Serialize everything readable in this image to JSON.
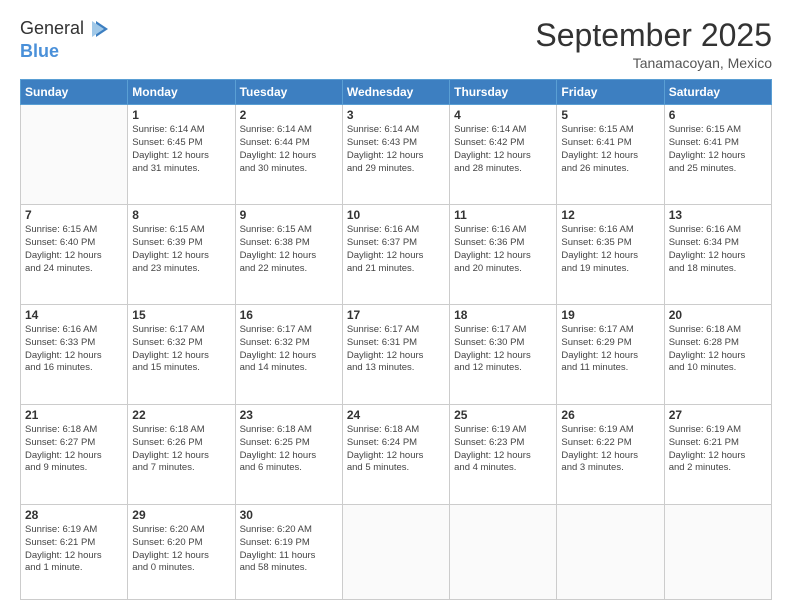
{
  "header": {
    "logo": {
      "text_general": "General",
      "text_blue": "Blue"
    },
    "title": "September 2025",
    "subtitle": "Tanamacoyan, Mexico"
  },
  "calendar": {
    "days_of_week": [
      "Sunday",
      "Monday",
      "Tuesday",
      "Wednesday",
      "Thursday",
      "Friday",
      "Saturday"
    ],
    "weeks": [
      [
        {
          "day": "",
          "info": ""
        },
        {
          "day": "1",
          "info": "Sunrise: 6:14 AM\nSunset: 6:45 PM\nDaylight: 12 hours\nand 31 minutes."
        },
        {
          "day": "2",
          "info": "Sunrise: 6:14 AM\nSunset: 6:44 PM\nDaylight: 12 hours\nand 30 minutes."
        },
        {
          "day": "3",
          "info": "Sunrise: 6:14 AM\nSunset: 6:43 PM\nDaylight: 12 hours\nand 29 minutes."
        },
        {
          "day": "4",
          "info": "Sunrise: 6:14 AM\nSunset: 6:42 PM\nDaylight: 12 hours\nand 28 minutes."
        },
        {
          "day": "5",
          "info": "Sunrise: 6:15 AM\nSunset: 6:41 PM\nDaylight: 12 hours\nand 26 minutes."
        },
        {
          "day": "6",
          "info": "Sunrise: 6:15 AM\nSunset: 6:41 PM\nDaylight: 12 hours\nand 25 minutes."
        }
      ],
      [
        {
          "day": "7",
          "info": "Sunrise: 6:15 AM\nSunset: 6:40 PM\nDaylight: 12 hours\nand 24 minutes."
        },
        {
          "day": "8",
          "info": "Sunrise: 6:15 AM\nSunset: 6:39 PM\nDaylight: 12 hours\nand 23 minutes."
        },
        {
          "day": "9",
          "info": "Sunrise: 6:15 AM\nSunset: 6:38 PM\nDaylight: 12 hours\nand 22 minutes."
        },
        {
          "day": "10",
          "info": "Sunrise: 6:16 AM\nSunset: 6:37 PM\nDaylight: 12 hours\nand 21 minutes."
        },
        {
          "day": "11",
          "info": "Sunrise: 6:16 AM\nSunset: 6:36 PM\nDaylight: 12 hours\nand 20 minutes."
        },
        {
          "day": "12",
          "info": "Sunrise: 6:16 AM\nSunset: 6:35 PM\nDaylight: 12 hours\nand 19 minutes."
        },
        {
          "day": "13",
          "info": "Sunrise: 6:16 AM\nSunset: 6:34 PM\nDaylight: 12 hours\nand 18 minutes."
        }
      ],
      [
        {
          "day": "14",
          "info": "Sunrise: 6:16 AM\nSunset: 6:33 PM\nDaylight: 12 hours\nand 16 minutes."
        },
        {
          "day": "15",
          "info": "Sunrise: 6:17 AM\nSunset: 6:32 PM\nDaylight: 12 hours\nand 15 minutes."
        },
        {
          "day": "16",
          "info": "Sunrise: 6:17 AM\nSunset: 6:32 PM\nDaylight: 12 hours\nand 14 minutes."
        },
        {
          "day": "17",
          "info": "Sunrise: 6:17 AM\nSunset: 6:31 PM\nDaylight: 12 hours\nand 13 minutes."
        },
        {
          "day": "18",
          "info": "Sunrise: 6:17 AM\nSunset: 6:30 PM\nDaylight: 12 hours\nand 12 minutes."
        },
        {
          "day": "19",
          "info": "Sunrise: 6:17 AM\nSunset: 6:29 PM\nDaylight: 12 hours\nand 11 minutes."
        },
        {
          "day": "20",
          "info": "Sunrise: 6:18 AM\nSunset: 6:28 PM\nDaylight: 12 hours\nand 10 minutes."
        }
      ],
      [
        {
          "day": "21",
          "info": "Sunrise: 6:18 AM\nSunset: 6:27 PM\nDaylight: 12 hours\nand 9 minutes."
        },
        {
          "day": "22",
          "info": "Sunrise: 6:18 AM\nSunset: 6:26 PM\nDaylight: 12 hours\nand 7 minutes."
        },
        {
          "day": "23",
          "info": "Sunrise: 6:18 AM\nSunset: 6:25 PM\nDaylight: 12 hours\nand 6 minutes."
        },
        {
          "day": "24",
          "info": "Sunrise: 6:18 AM\nSunset: 6:24 PM\nDaylight: 12 hours\nand 5 minutes."
        },
        {
          "day": "25",
          "info": "Sunrise: 6:19 AM\nSunset: 6:23 PM\nDaylight: 12 hours\nand 4 minutes."
        },
        {
          "day": "26",
          "info": "Sunrise: 6:19 AM\nSunset: 6:22 PM\nDaylight: 12 hours\nand 3 minutes."
        },
        {
          "day": "27",
          "info": "Sunrise: 6:19 AM\nSunset: 6:21 PM\nDaylight: 12 hours\nand 2 minutes."
        }
      ],
      [
        {
          "day": "28",
          "info": "Sunrise: 6:19 AM\nSunset: 6:21 PM\nDaylight: 12 hours\nand 1 minute."
        },
        {
          "day": "29",
          "info": "Sunrise: 6:20 AM\nSunset: 6:20 PM\nDaylight: 12 hours\nand 0 minutes."
        },
        {
          "day": "30",
          "info": "Sunrise: 6:20 AM\nSunset: 6:19 PM\nDaylight: 11 hours\nand 58 minutes."
        },
        {
          "day": "",
          "info": ""
        },
        {
          "day": "",
          "info": ""
        },
        {
          "day": "",
          "info": ""
        },
        {
          "day": "",
          "info": ""
        }
      ]
    ]
  }
}
